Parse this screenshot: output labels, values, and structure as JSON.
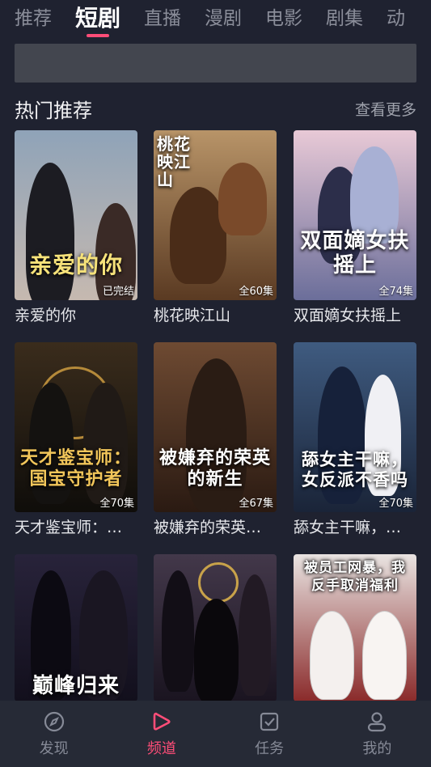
{
  "tabs": [
    {
      "label": "推荐",
      "active": false
    },
    {
      "label": "短剧",
      "active": true
    },
    {
      "label": "直播",
      "active": false
    },
    {
      "label": "漫剧",
      "active": false
    },
    {
      "label": "电影",
      "active": false
    },
    {
      "label": "剧集",
      "active": false
    },
    {
      "label": "动",
      "active": false
    }
  ],
  "section": {
    "title": "热门推荐",
    "more": "查看更多"
  },
  "cards": [
    {
      "title": "亲爱的你",
      "poster_text": "亲爱的你",
      "badge": "已完结",
      "bg": [
        "#8fa3b8",
        "#c6b9b0"
      ]
    },
    {
      "title": "桃花映江山",
      "poster_text": "桃花映江山",
      "badge": "全60集",
      "bg": [
        "#b89468",
        "#5a3a22"
      ]
    },
    {
      "title": "双面嫡女扶摇上",
      "poster_text": "双面嫡女扶摇上",
      "badge": "全74集",
      "bg": [
        "#e8c9d6",
        "#6b6e9a"
      ]
    },
    {
      "title": "天才鉴宝师：…",
      "poster_text": "天才鉴宝师：国宝守护者",
      "badge": "全70集",
      "bg": [
        "#3a2c1c",
        "#0f0d0a"
      ]
    },
    {
      "title": "被嫌弃的荣英…",
      "poster_text": "被嫌弃的荣英的新生",
      "badge": "全67集",
      "bg": [
        "#6e4a32",
        "#2a1a12"
      ]
    },
    {
      "title": "舔女主干嘛，…",
      "poster_text": "舔女主干嘛，女反派不香吗",
      "badge": "全70集",
      "bg": [
        "#3f5b80",
        "#1a2438"
      ]
    },
    {
      "title": "",
      "poster_text": "巅峰归来",
      "badge": "",
      "bg": [
        "#28233a",
        "#120f1c"
      ]
    },
    {
      "title": "",
      "poster_text": "",
      "badge": "",
      "bg": [
        "#43384a",
        "#1a1420"
      ]
    },
    {
      "title": "",
      "poster_text": "被员工网暴，我反手取消福利",
      "badge": "",
      "bg": [
        "#e9e4e2",
        "#8a2a2a"
      ]
    }
  ],
  "nav": [
    {
      "label": "发现",
      "icon": "compass-icon",
      "active": false
    },
    {
      "label": "频道",
      "icon": "play-icon",
      "active": true
    },
    {
      "label": "任务",
      "icon": "task-icon",
      "active": false
    },
    {
      "label": "我的",
      "icon": "profile-icon",
      "active": false
    }
  ],
  "colors": {
    "accent": "#ff4d78",
    "background": "#1f2230"
  }
}
